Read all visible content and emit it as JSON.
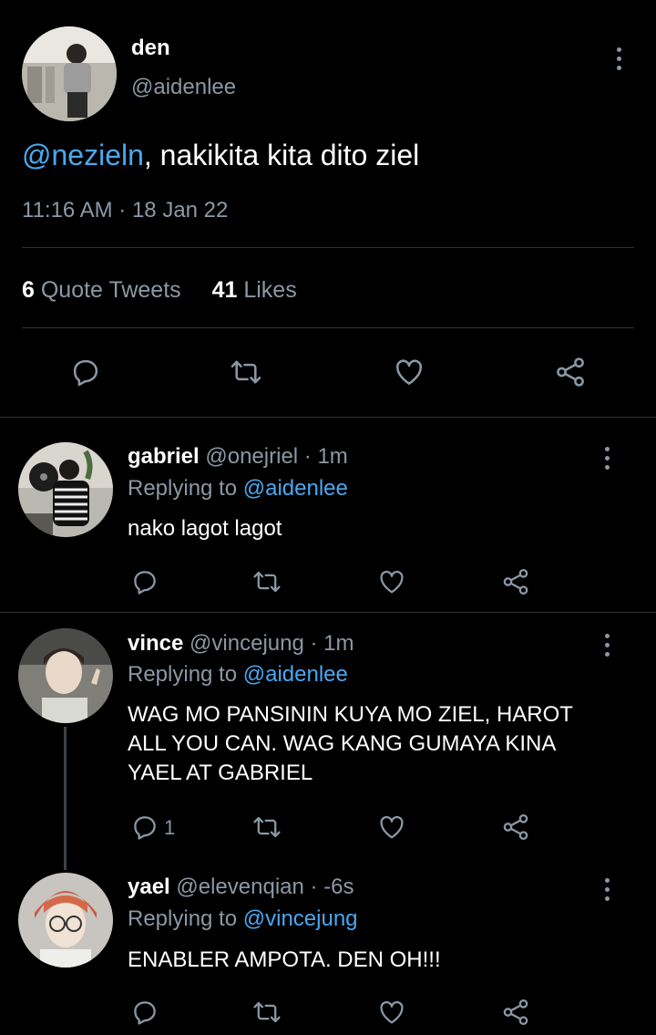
{
  "main_tweet": {
    "display_name": "den",
    "handle": "@aidenlee",
    "mention": "@nezieln",
    "text": ", nakikita kita dito ziel",
    "timestamp": "11:16 AM · 18 Jan 22",
    "quote_count": "6",
    "quote_label": "Quote Tweets",
    "like_count": "41",
    "like_label": "Likes"
  },
  "replies": [
    {
      "display_name": "gabriel",
      "handle": "@onejriel",
      "time": "· 1m",
      "replying_prefix": "Replying to",
      "replying_to": "@aidenlee",
      "text": "nako lagot lagot",
      "reply_count": ""
    },
    {
      "display_name": "vince",
      "handle": "@vincejung",
      "time": "· 1m",
      "replying_prefix": "Replying to",
      "replying_to": "@aidenlee",
      "text_lines": [
        "WAG MO PANSININ KUYA MO ZIEL, HAROT",
        "ALL YOU CAN. WAG KANG GUMAYA KINA",
        "YAEL AT GABRIEL"
      ],
      "reply_count": "1"
    },
    {
      "display_name": "yael",
      "handle": "@elevenqian",
      "time": "· -6s",
      "replying_prefix": "Replying to",
      "replying_to": "@vincejung",
      "text": "ENABLER AMPOTA. DEN OH!!!",
      "reply_count": ""
    }
  ],
  "icons": [
    "reply-icon",
    "retweet-icon",
    "like-icon",
    "share-icon",
    "more-icon"
  ],
  "colors": {
    "background": "#000000",
    "link": "#4aa8f0",
    "muted": "#8b98a5",
    "divider": "#2f3336"
  }
}
